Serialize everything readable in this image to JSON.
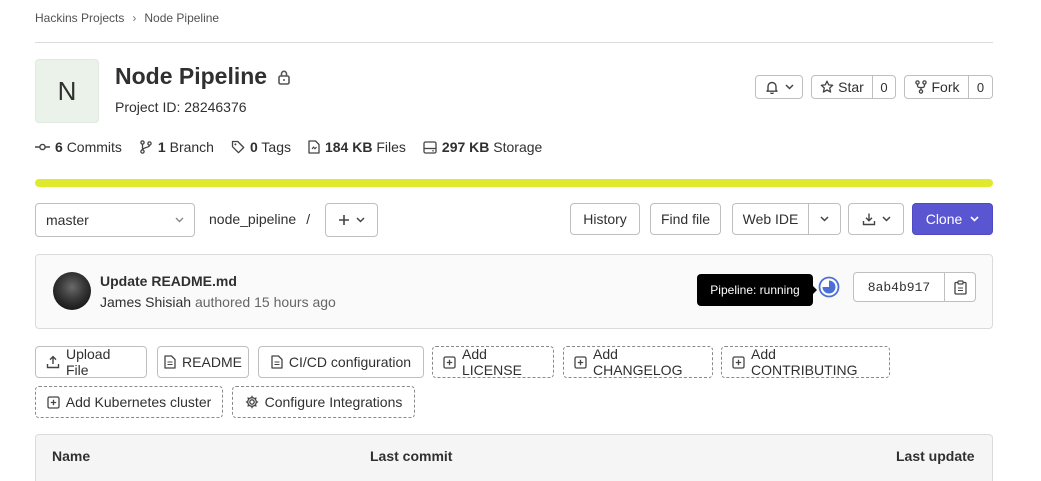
{
  "breadcrumb": {
    "group": "Hackins Projects",
    "separator": "›",
    "project": "Node Pipeline"
  },
  "project": {
    "avatar_letter": "N",
    "name": "Node Pipeline",
    "visibility_icon": "lock-icon",
    "id_text": "Project ID: 28246376"
  },
  "actions": {
    "notifications_icon": "bell-icon",
    "star_label": "Star",
    "star_count": "0",
    "fork_label": "Fork",
    "fork_count": "0"
  },
  "stats": [
    {
      "icon": "commit-icon",
      "value": "6",
      "label": "Commits"
    },
    {
      "icon": "branch-icon",
      "value": "1",
      "label": "Branch"
    },
    {
      "icon": "tag-icon",
      "value": "0",
      "label": "Tags"
    },
    {
      "icon": "file-icon",
      "value": "184 KB",
      "label": "Files"
    },
    {
      "icon": "storage-icon",
      "value": "297 KB",
      "label": "Storage"
    }
  ],
  "storage_bar": {
    "color": "#dfea2f",
    "fill": 1.0
  },
  "toolbar": {
    "branch": "master",
    "path": "node_pipeline",
    "path_separator": "/",
    "history": "History",
    "find_file": "Find file",
    "web_ide": "Web IDE",
    "clone": "Clone",
    "clone_color": "#5a55d1"
  },
  "commit": {
    "title": "Update README.md",
    "author": "James Shisiah",
    "action": "authored",
    "time": "15 hours ago",
    "tooltip": "Pipeline: running",
    "sha": "8ab4b917"
  },
  "quick_actions": {
    "upload": "Upload File",
    "readme": "README",
    "cicd": "CI/CD configuration",
    "license": "Add LICENSE",
    "changelog": "Add CHANGELOG",
    "contributing": "Add CONTRIBUTING",
    "kubernetes": "Add Kubernetes cluster",
    "integrations": "Configure Integrations"
  },
  "table": {
    "col_name": "Name",
    "col_commit": "Last commit",
    "col_update": "Last update"
  }
}
